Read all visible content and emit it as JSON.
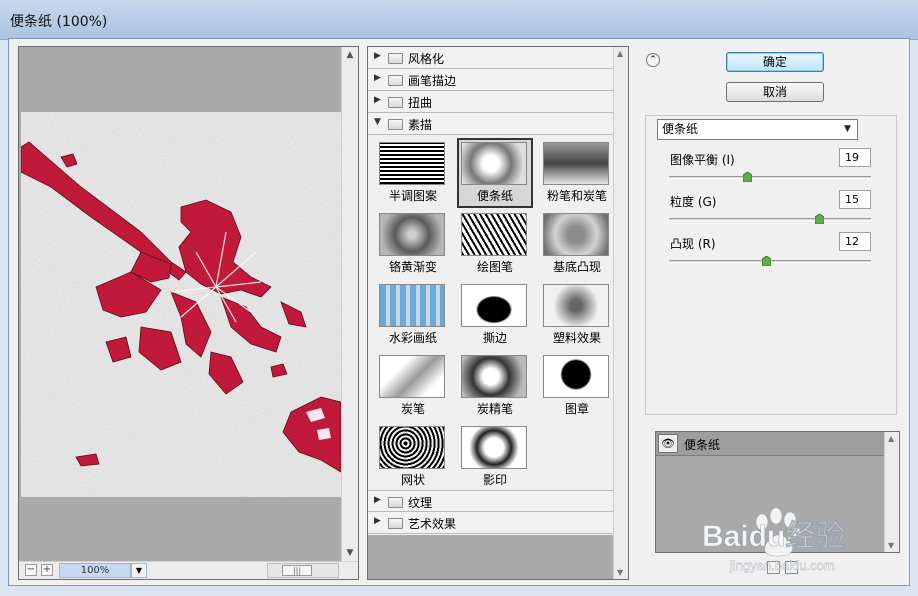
{
  "window": {
    "title": "便条纸 (100%)"
  },
  "preview": {
    "zoom": "100%",
    "zoom_out": "−",
    "zoom_in": "+"
  },
  "gallery": {
    "categories_top": [
      "风格化",
      "画笔描边",
      "扭曲"
    ],
    "open_category": "素描",
    "filters": [
      "半调图案",
      "便条纸",
      "粉笔和炭笔",
      "铬黄渐变",
      "绘图笔",
      "基底凸现",
      "水彩画纸",
      "撕边",
      "塑料效果",
      "炭笔",
      "炭精笔",
      "图章",
      "网状",
      "影印"
    ],
    "selected_filter": "便条纸",
    "categories_bottom": [
      "纹理",
      "艺术效果"
    ]
  },
  "buttons": {
    "ok": "确定",
    "cancel": "取消"
  },
  "settings": {
    "filter_select": "便条纸",
    "params": [
      {
        "label": "图像平衡 (I)",
        "value": "19",
        "fraction": 0.38
      },
      {
        "label": "粒度 (G)",
        "value": "15",
        "fraction": 0.75
      },
      {
        "label": "凸现 (R)",
        "value": "12",
        "fraction": 0.48
      }
    ]
  },
  "layers": {
    "items": [
      "便条纸"
    ]
  },
  "watermark": {
    "brand": "Baidu经验",
    "url": "jingyan.baidu.com"
  },
  "colors": {
    "accent": "#c0193a",
    "paper": "#e9e9e9",
    "panel": "#f0f0f0",
    "dark_panel": "#a9a9a9"
  }
}
